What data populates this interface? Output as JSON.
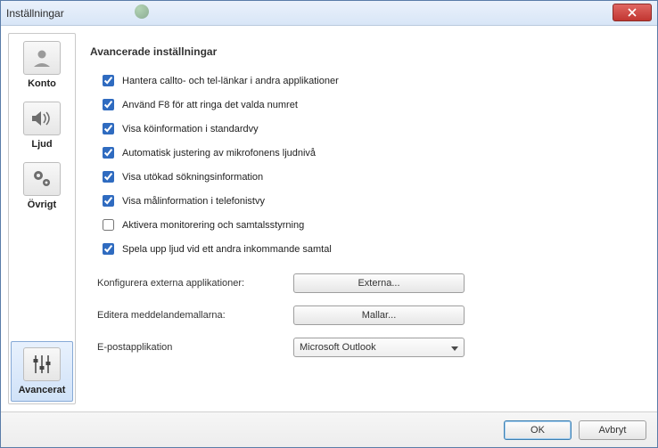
{
  "window": {
    "title": "Inställningar"
  },
  "bg_app": {
    "label": ""
  },
  "sidebar": {
    "items": [
      {
        "label": "Konto"
      },
      {
        "label": "Ljud"
      },
      {
        "label": "Övrigt"
      },
      {
        "label": "Avancerat"
      }
    ]
  },
  "main": {
    "heading": "Avancerade inställningar",
    "checkboxes": [
      {
        "label": "Hantera callto- och tel-länkar i andra applikationer",
        "checked": true
      },
      {
        "label": "Använd F8 för att ringa det valda numret",
        "checked": true
      },
      {
        "label": "Visa köinformation i standardvy",
        "checked": true
      },
      {
        "label": "Automatisk justering av mikrofonens ljudnivå",
        "checked": true
      },
      {
        "label": "Visa utökad sökningsinformation",
        "checked": true
      },
      {
        "label": "Visa målinformation i telefonistvy",
        "checked": true
      },
      {
        "label": "Aktivera monitorering och samtalsstyrning",
        "checked": false
      },
      {
        "label": "Spela upp ljud vid ett andra inkommande samtal",
        "checked": true
      }
    ],
    "config": {
      "external_label": "Konfigurera externa applikationer:",
      "external_button": "Externa...",
      "templates_label": "Editera meddelandemallarna:",
      "templates_button": "Mallar...",
      "email_label": "E-postapplikation",
      "email_selected": "Microsoft Outlook"
    }
  },
  "footer": {
    "ok": "OK",
    "cancel": "Avbryt"
  }
}
